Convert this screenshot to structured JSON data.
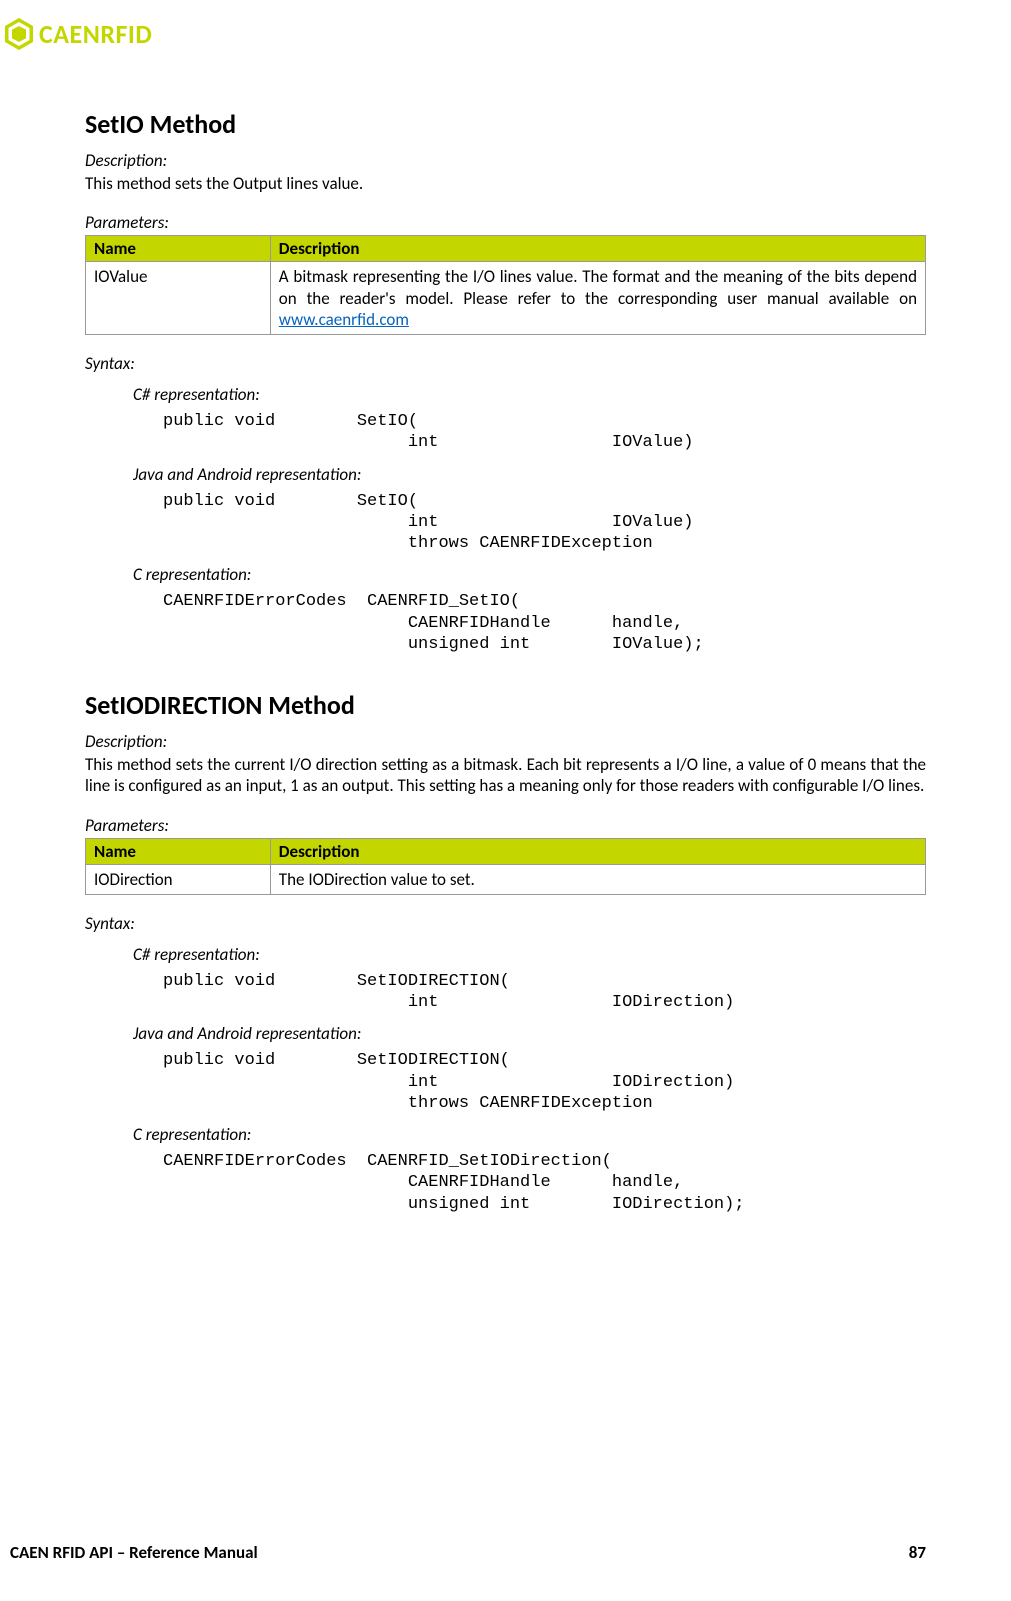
{
  "logo_text": "CAENRFID",
  "method1": {
    "title": "SetIO Method",
    "desc_label": "Description:",
    "desc_text": "This method sets the Output lines value.",
    "params_label": "Parameters:",
    "table": {
      "header_name": "Name",
      "header_desc": "Description",
      "row_name": "IOValue",
      "row_desc_pre": "A bitmask representing the I/O lines value. The format and the meaning of the bits depend on the reader's model. Please refer to the corresponding user manual available on ",
      "row_desc_link": "www.caenrfid.com"
    },
    "syntax_label": "Syntax:",
    "csharp_label": "C# representation:",
    "csharp_code": "public void        SetIO(\n                        int                 IOValue)",
    "java_label": "Java and Android representation:",
    "java_code": "public void        SetIO(\n                        int                 IOValue)\n                        throws CAENRFIDException",
    "c_label": "C representation:",
    "c_code": "CAENRFIDErrorCodes  CAENRFID_SetIO(\n                        CAENRFIDHandle      handle,\n                        unsigned int        IOValue);"
  },
  "method2": {
    "title": "SetIODIRECTION Method",
    "desc_label": "Description:",
    "desc_text": "This method sets the current I/O direction setting as a bitmask. Each bit represents a I/O line, a value of 0 means that the line is configured as an input, 1 as an output. This setting has a meaning only for those readers with configurable I/O lines.",
    "params_label": "Parameters:",
    "table": {
      "header_name": "Name",
      "header_desc": "Description",
      "row_name": "IODirection",
      "row_desc": "The IODirection value to set."
    },
    "syntax_label": "Syntax:",
    "csharp_label": "C# representation:",
    "csharp_code": "public void        SetIODIRECTION(\n                        int                 IODirection)",
    "java_label": "Java and Android representation:",
    "java_code": "public void        SetIODIRECTION(\n                        int                 IODirection)\n                        throws CAENRFIDException",
    "c_label": "C representation:",
    "c_code": "CAENRFIDErrorCodes  CAENRFID_SetIODirection(\n                        CAENRFIDHandle      handle,\n                        unsigned int        IODirection);"
  },
  "footer_left": "CAEN RFID API – Reference Manual",
  "footer_right": "87"
}
